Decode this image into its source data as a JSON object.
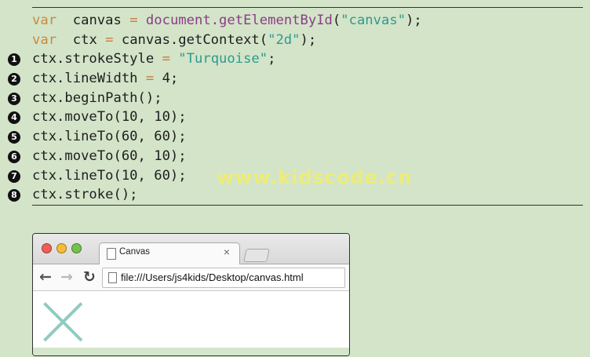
{
  "code": [
    {
      "marker": "",
      "tokens": [
        [
          "kw",
          "var"
        ],
        [
          "",
          "  canvas "
        ],
        [
          "op",
          "="
        ],
        [
          "",
          " "
        ],
        [
          "fn",
          "document.getElementById"
        ],
        [
          "",
          "("
        ],
        [
          "str",
          "\"canvas\""
        ],
        [
          "",
          ");"
        ]
      ]
    },
    {
      "marker": "",
      "tokens": [
        [
          "kw",
          "var"
        ],
        [
          "",
          "  ctx "
        ],
        [
          "op",
          "="
        ],
        [
          "",
          " canvas.getContext("
        ],
        [
          "str",
          "\"2d\""
        ],
        [
          "",
          ");"
        ]
      ]
    },
    {
      "marker": "1",
      "tokens": [
        [
          "",
          "ctx.strokeStyle "
        ],
        [
          "op",
          "="
        ],
        [
          "",
          " "
        ],
        [
          "str",
          "\"Turquoise\""
        ],
        [
          "",
          ";"
        ]
      ]
    },
    {
      "marker": "2",
      "tokens": [
        [
          "",
          "ctx.lineWidth "
        ],
        [
          "op",
          "="
        ],
        [
          "",
          " 4;"
        ]
      ]
    },
    {
      "marker": "3",
      "tokens": [
        [
          "",
          "ctx.beginPath();"
        ]
      ]
    },
    {
      "marker": "4",
      "tokens": [
        [
          "",
          "ctx.moveTo(10, 10);"
        ]
      ]
    },
    {
      "marker": "5",
      "tokens": [
        [
          "",
          "ctx.lineTo(60, 60);"
        ]
      ]
    },
    {
      "marker": "6",
      "tokens": [
        [
          "",
          "ctx.moveTo(60, 10);"
        ]
      ]
    },
    {
      "marker": "7",
      "tokens": [
        [
          "",
          "ctx.lineTo(10, 60);"
        ]
      ]
    },
    {
      "marker": "8",
      "tokens": [
        [
          "",
          "ctx.stroke();"
        ]
      ]
    }
  ],
  "watermark": "www.kidscode.cn",
  "browser": {
    "tab_title": "Canvas",
    "tab_close": "×",
    "back_icon": "←",
    "forward_icon": "→",
    "reload_icon": "↻",
    "url": "file:///Users/js4kids/Desktop/canvas.html"
  },
  "canvas_drawing": {
    "stroke_color": "#8fcbc1",
    "line_width": 4,
    "segments": [
      [
        10,
        10,
        60,
        60
      ],
      [
        60,
        10,
        10,
        60
      ]
    ]
  }
}
